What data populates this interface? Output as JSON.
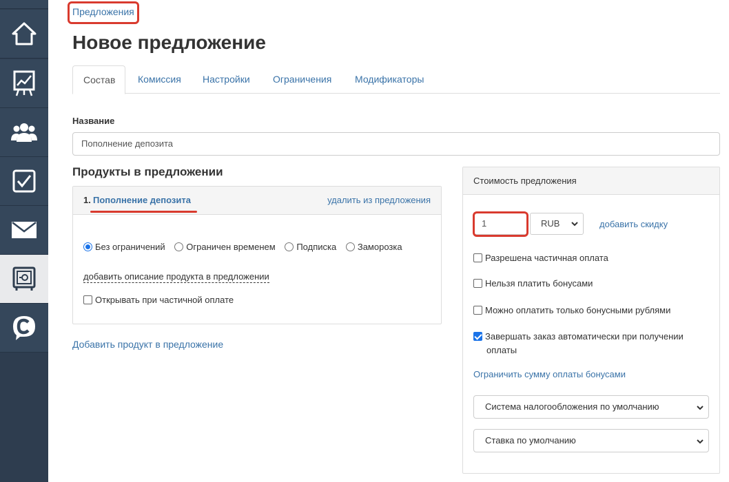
{
  "breadcrumb": {
    "label": "Предложения"
  },
  "page": {
    "title": "Новое предложение"
  },
  "tabs": [
    {
      "label": "Состав",
      "active": true
    },
    {
      "label": "Комиссия"
    },
    {
      "label": "Настройки"
    },
    {
      "label": "Ограничения"
    },
    {
      "label": "Модификаторы"
    }
  ],
  "name_field": {
    "label": "Название",
    "value": "Пополнение депозита"
  },
  "products": {
    "title": "Продукты в предложении",
    "items": [
      {
        "number": "1.",
        "name": "Пополнение депозита",
        "remove_label": "удалить из предложения",
        "radio_options": [
          {
            "label": "Без ограничений",
            "selected": true
          },
          {
            "label": "Ограничен временем"
          },
          {
            "label": "Подписка"
          },
          {
            "label": "Заморозка"
          }
        ],
        "add_description_label": "добавить описание продукта в предложении",
        "open_on_partial_label": "Открывать при частичной оплате",
        "open_on_partial_checked": false
      }
    ],
    "add_product_label": "Добавить продукт в предложение"
  },
  "price": {
    "title": "Стоимость предложения",
    "amount": "1",
    "currency": "RUB",
    "add_discount_label": "добавить скидку",
    "options": [
      {
        "label": "Разрешена частичная оплата",
        "checked": false
      },
      {
        "label": "Нельзя платить бонусами",
        "checked": false
      },
      {
        "label": "Можно оплатить только бонусными рублями",
        "checked": false
      },
      {
        "label": "Завершать заказ автоматически при получении",
        "label_line2": "оплаты",
        "checked": true
      }
    ],
    "limit_bonus_label": "Ограничить сумму оплаты бонусами",
    "tax_system": "Система налогообложения по умолчанию",
    "tax_rate": "Ставка по умолчанию"
  },
  "sidebar": {
    "items": [
      {
        "icon": "home-icon"
      },
      {
        "icon": "chart-board-icon"
      },
      {
        "icon": "users-icon"
      },
      {
        "icon": "checkbox-icon"
      },
      {
        "icon": "mail-icon"
      },
      {
        "icon": "safe-icon",
        "active": true
      },
      {
        "icon": "chat-c-icon"
      }
    ]
  },
  "colors": {
    "highlight": "#d93a2e",
    "link": "#3a73a8",
    "sidebar": "#2e3d4f"
  }
}
